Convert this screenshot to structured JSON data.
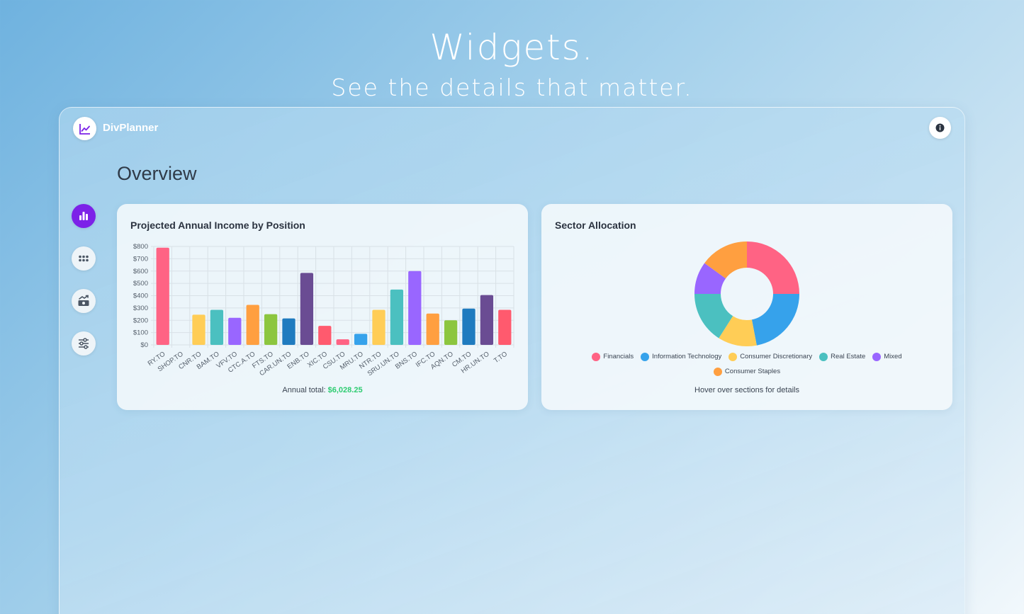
{
  "hero": {
    "title": "Widgets.",
    "subtitle": "See the details that matter."
  },
  "app": {
    "brand": "DivPlanner",
    "page_title": "Overview",
    "info_icon": "info-icon",
    "nav": [
      {
        "name": "overview",
        "icon": "bar-chart-icon",
        "active": true
      },
      {
        "name": "holdings",
        "icon": "grid-dots-icon",
        "active": false
      },
      {
        "name": "growth",
        "icon": "cash-growth-icon",
        "active": false
      },
      {
        "name": "settings",
        "icon": "sliders-icon",
        "active": false
      }
    ]
  },
  "income_card": {
    "title": "Projected Annual Income by Position",
    "total_label": "Annual total:",
    "total_value": "$6,028.25"
  },
  "sector_card": {
    "title": "Sector Allocation",
    "hover_note": "Hover over sections for details"
  },
  "colors": {
    "accent": "#7c22e8",
    "total_green": "#2ecc71"
  },
  "chart_data": [
    {
      "type": "bar",
      "title": "Projected Annual Income by Position",
      "categories": [
        "RY.TO",
        "SHOP.TO",
        "CNR.TO",
        "BAM.TO",
        "VFV.TO",
        "CTC.A.TO",
        "FTS.TO",
        "CAR.UN.TO",
        "ENB.TO",
        "XIC.TO",
        "CSU.TO",
        "MRU.TO",
        "NTR.TO",
        "SRU.UN.TO",
        "BNS.TO",
        "IFC.TO",
        "AQN.TO",
        "CM.TO",
        "HR.UN.TO",
        "T.TO"
      ],
      "values": [
        790,
        0,
        245,
        285,
        220,
        325,
        250,
        215,
        585,
        155,
        45,
        90,
        285,
        450,
        600,
        255,
        200,
        295,
        405,
        285
      ],
      "colors": [
        "#ff6384",
        "#36a2eb",
        "#ffcd56",
        "#4bc0c0",
        "#9966ff",
        "#ff9f40",
        "#8cc63f",
        "#1f7bbf",
        "#6a4c93",
        "#ff5a6e",
        "#ff6384",
        "#36a2eb",
        "#ffcd56",
        "#4bc0c0",
        "#9966ff",
        "#ff9f40",
        "#8cc63f",
        "#1f7bbf",
        "#6a4c93",
        "#ff5a6e"
      ],
      "ylim": [
        0,
        800
      ],
      "yticks": [
        "$0",
        "$100",
        "$200",
        "$300",
        "$400",
        "$500",
        "$600",
        "$700",
        "$800"
      ],
      "grid": true
    },
    {
      "type": "pie",
      "title": "Sector Allocation",
      "labels": [
        "Financials",
        "Information Technology",
        "Consumer Discretionary",
        "Real Estate",
        "Mixed",
        "Consumer Staples"
      ],
      "values": [
        25,
        22,
        12,
        16,
        10,
        15
      ],
      "colors": [
        "#ff6384",
        "#36a2eb",
        "#ffcd56",
        "#4bc0c0",
        "#9966ff",
        "#ff9f40"
      ],
      "legend": "bottom"
    }
  ]
}
